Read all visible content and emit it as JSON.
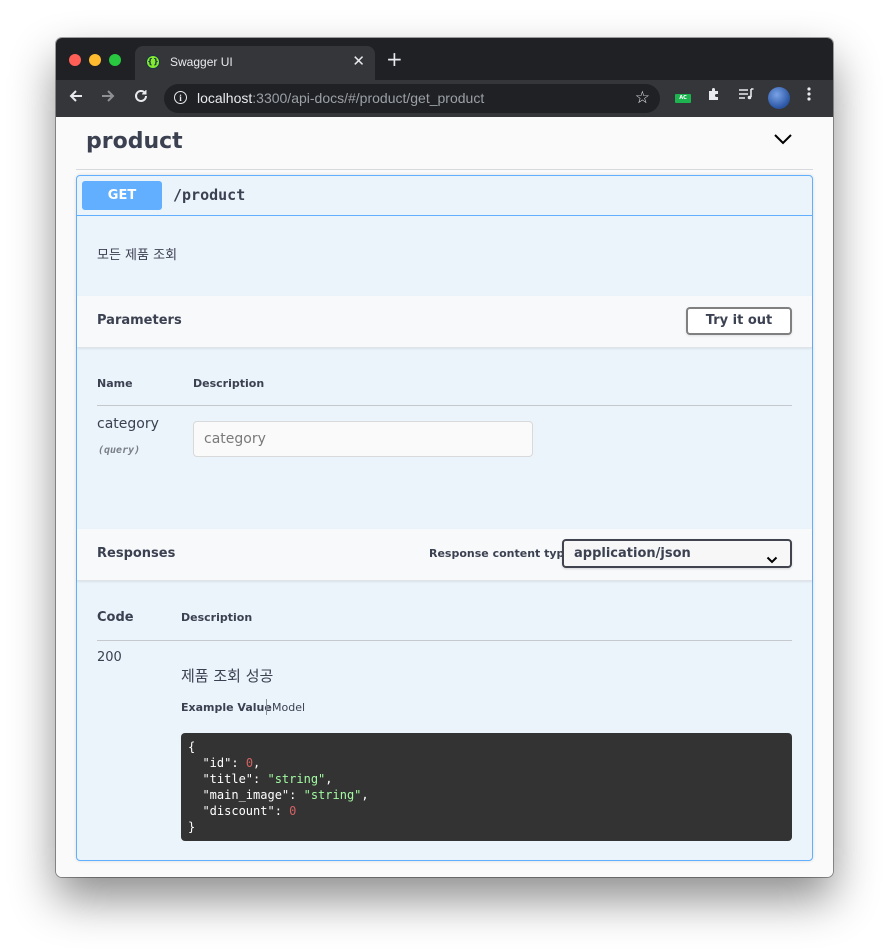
{
  "browser": {
    "tab_title": "Swagger UI",
    "tab_close": "✕",
    "new_tab": "+",
    "url_host": "localhost",
    "url_rest": ":3300/api-docs/#/product/get_product",
    "extension_badge": "AC"
  },
  "tag": {
    "title": "product"
  },
  "operation": {
    "method": "GET",
    "path": "/product",
    "description": "모든 제품 조회",
    "parameters": {
      "title": "Parameters",
      "try_button": "Try it out",
      "col_name": "Name",
      "col_description": "Description",
      "items": [
        {
          "name": "category",
          "in": "(query)",
          "placeholder": "category"
        }
      ]
    },
    "responses": {
      "title": "Responses",
      "content_type_label": "Response content type",
      "content_type_value": "application/json",
      "col_code": "Code",
      "col_description": "Description",
      "items": [
        {
          "code": "200",
          "description": "제품 조회 성공",
          "tab_example": "Example Value",
          "tab_model": "Model",
          "example": [
            {
              "key": "\"id\"",
              "value": "0",
              "type": "number"
            },
            {
              "key": "\"title\"",
              "value": "\"string\"",
              "type": "string"
            },
            {
              "key": "\"main_image\"",
              "value": "\"string\"",
              "type": "string"
            },
            {
              "key": "\"discount\"",
              "value": "0",
              "type": "number"
            }
          ]
        }
      ]
    }
  },
  "colors": {
    "get_accent": "#61affe",
    "opblock_bg": "#ebf3fb",
    "code_bg": "#333333",
    "json_string": "#a2fca2",
    "json_number": "#d36363"
  }
}
